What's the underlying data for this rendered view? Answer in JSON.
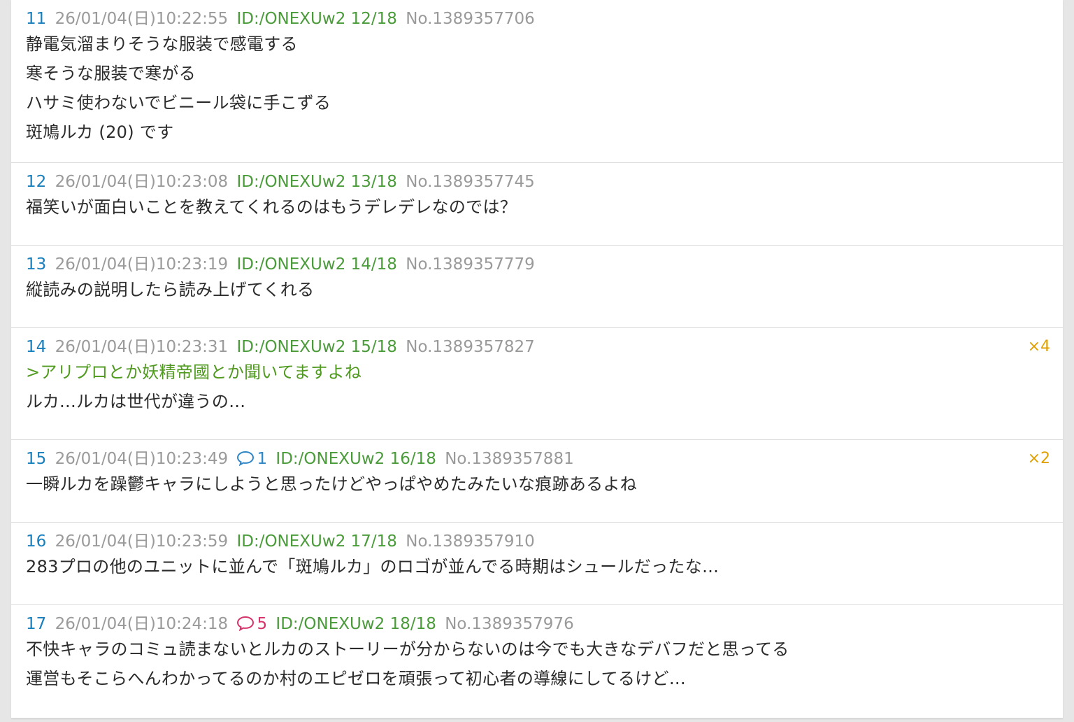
{
  "posts": [
    {
      "num": "11",
      "date": "26/01/04(日)10:22:55",
      "id": "ID:/ONEXUw2 12/18",
      "no": "No.1389357706",
      "lines": [
        {
          "text": "静電気溜まりそうな服装で感電する",
          "quote": false
        },
        {
          "text": "寒そうな服装で寒がる",
          "quote": false
        },
        {
          "text": "ハサミ使わないでビニール袋に手こずる",
          "quote": false
        },
        {
          "text": "斑鳩ルカ (20) です",
          "quote": false
        }
      ]
    },
    {
      "num": "12",
      "date": "26/01/04(日)10:23:08",
      "id": "ID:/ONEXUw2 13/18",
      "no": "No.1389357745",
      "lines": [
        {
          "text": "福笑いが面白いことを教えてくれるのはもうデレデレなのでは？",
          "quote": false
        }
      ]
    },
    {
      "num": "13",
      "date": "26/01/04(日)10:23:19",
      "id": "ID:/ONEXUw2 14/18",
      "no": "No.1389357779",
      "lines": [
        {
          "text": "縦読みの説明したら読み上げてくれる",
          "quote": false
        }
      ]
    },
    {
      "num": "14",
      "date": "26/01/04(日)10:23:31",
      "id": "ID:/ONEXUw2 15/18",
      "no": "No.1389357827",
      "mult": "×4",
      "lines": [
        {
          "text": ">アリプロとか妖精帝國とか聞いてますよね",
          "quote": true
        },
        {
          "text": "ルカ…ルカは世代が違うの…",
          "quote": false
        }
      ]
    },
    {
      "num": "15",
      "date": "26/01/04(日)10:23:49",
      "replies": "1",
      "reply_color": "#2f86c6",
      "id": "ID:/ONEXUw2 16/18",
      "no": "No.1389357881",
      "mult": "×2",
      "lines": [
        {
          "text": "一瞬ルカを躁鬱キャラにしようと思ったけどやっぱやめたみたいな痕跡あるよね",
          "quote": false
        }
      ]
    },
    {
      "num": "16",
      "date": "26/01/04(日)10:23:59",
      "id": "ID:/ONEXUw2 17/18",
      "no": "No.1389357910",
      "lines": [
        {
          "text": "283プロの他のユニットに並んで「斑鳩ルカ」のロゴが並んでる時期はシュールだったな…",
          "quote": false
        }
      ]
    },
    {
      "num": "17",
      "date": "26/01/04(日)10:24:18",
      "replies": "5",
      "reply_color": "#d6336c",
      "id": "ID:/ONEXUw2 18/18",
      "no": "No.1389357976",
      "lines": [
        {
          "text": "不快キャラのコミュ読まないとルカのストーリーが分からないのは今でも大きなデバフだと思ってる",
          "quote": false
        },
        {
          "text": "運営もそこらへんわかってるのか村のエピゼロを頑張って初心者の導線にしてるけど…",
          "quote": false
        }
      ]
    }
  ]
}
